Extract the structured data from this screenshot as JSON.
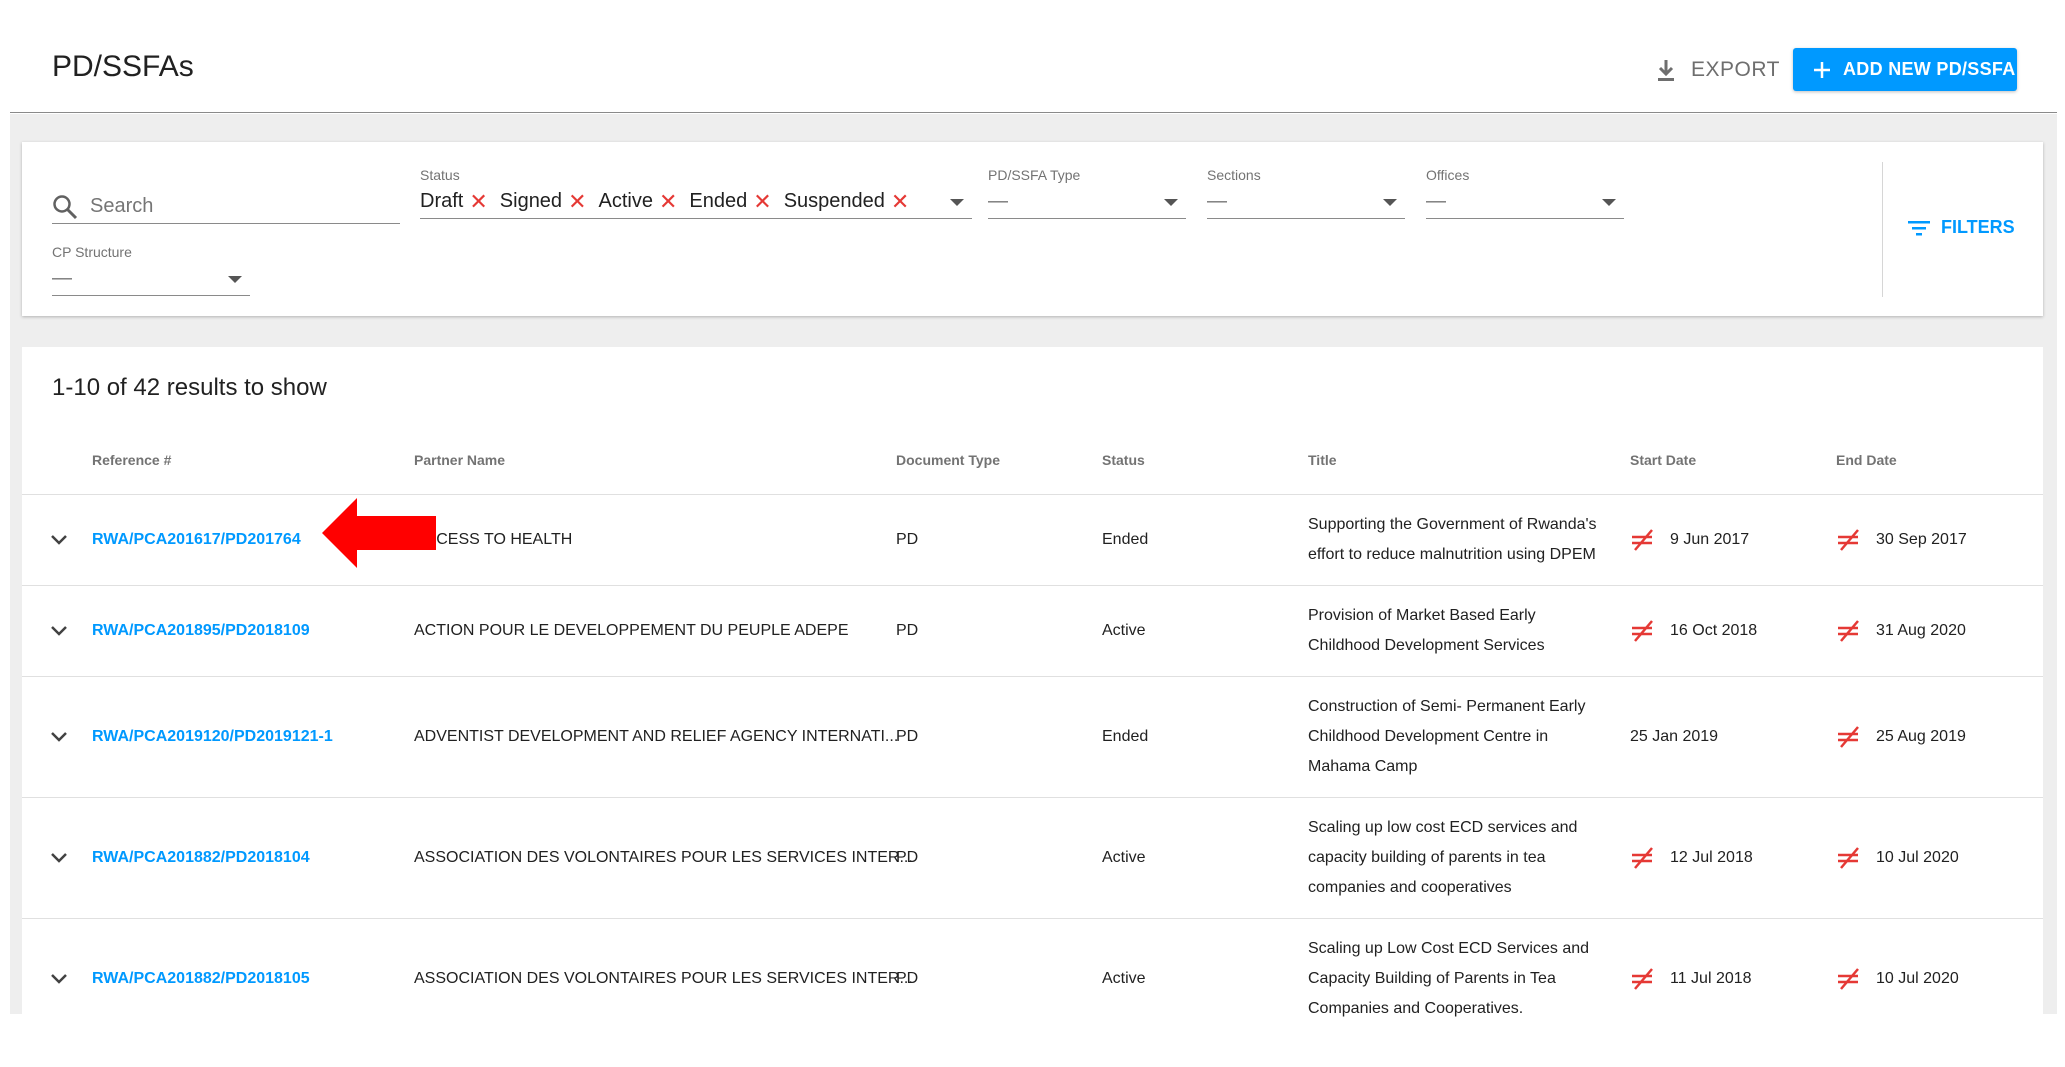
{
  "header": {
    "title": "PD/SSFAs",
    "export_label": "EXPORT",
    "add_label": "ADD NEW PD/SSFA"
  },
  "filters": {
    "search_placeholder": "Search",
    "status": {
      "label": "Status",
      "chips": [
        "Draft",
        "Signed",
        "Active",
        "Ended",
        "Suspended"
      ]
    },
    "type": {
      "label": "PD/SSFA Type",
      "value": "—"
    },
    "sections": {
      "label": "Sections",
      "value": "—"
    },
    "offices": {
      "label": "Offices",
      "value": "—"
    },
    "cp_structure": {
      "label": "CP Structure",
      "value": "—"
    },
    "filters_button": "FILTERS"
  },
  "results": {
    "count_text": "1-10 of 42 results to show",
    "columns": [
      "Reference #",
      "Partner Name",
      "Document Type",
      "Status",
      "Title",
      "Start Date",
      "End Date"
    ],
    "rows": [
      {
        "ref": "RWA/PCA201617/PD201764",
        "partner": "ACCESS TO HEALTH",
        "doc_type": "PD",
        "status": "Ended",
        "title": "Supporting the Government of Rwanda's effort to reduce malnutrition using DPEM",
        "start": "9 Jun 2017",
        "start_flag": true,
        "end": "30 Sep 2017",
        "end_flag": true
      },
      {
        "ref": "RWA/PCA201895/PD2018109",
        "partner": "ACTION POUR LE DEVELOPPEMENT DU PEUPLE ADEPE",
        "doc_type": "PD",
        "status": "Active",
        "title": "Provision of Market Based Early Childhood Development Services",
        "start": "16 Oct 2018",
        "start_flag": true,
        "end": "31 Aug 2020",
        "end_flag": true
      },
      {
        "ref": "RWA/PCA2019120/PD2019121-1",
        "partner": "ADVENTIST DEVELOPMENT AND RELIEF AGENCY INTERNATI...",
        "doc_type": "PD",
        "status": "Ended",
        "title": "Construction of Semi- Permanent Early Childhood Development Centre in Mahama Camp",
        "start": "25 Jan 2019",
        "start_flag": false,
        "end": "25 Aug 2019",
        "end_flag": true
      },
      {
        "ref": "RWA/PCA201882/PD2018104",
        "partner": "ASSOCIATION DES VOLONTAIRES POUR LES SERVICES INTER...",
        "doc_type": "PD",
        "status": "Active",
        "title": "Scaling up low cost ECD services and capacity building of parents in tea companies and cooperatives",
        "start": "12 Jul 2018",
        "start_flag": true,
        "end": "10 Jul 2020",
        "end_flag": true
      },
      {
        "ref": "RWA/PCA201882/PD2018105",
        "partner": "ASSOCIATION DES VOLONTAIRES POUR LES SERVICES INTER...",
        "doc_type": "PD",
        "status": "Active",
        "title": "Scaling up Low Cost ECD Services and Capacity Building of Parents in Tea Companies and Cooperatives.",
        "start": "11 Jul 2018",
        "start_flag": true,
        "end": "10 Jul 2020",
        "end_flag": true
      }
    ]
  },
  "colors": {
    "accent": "#0099ff",
    "danger": "#e53935",
    "annotation_arrow": "#ff0000"
  },
  "icons": {
    "export": "download-icon",
    "add": "plus-icon",
    "search": "search-icon",
    "filters": "filter-list-icon",
    "row_expand": "chevron-down-icon",
    "date_flag": "not-equal-icon",
    "chip_remove": "close-icon"
  }
}
